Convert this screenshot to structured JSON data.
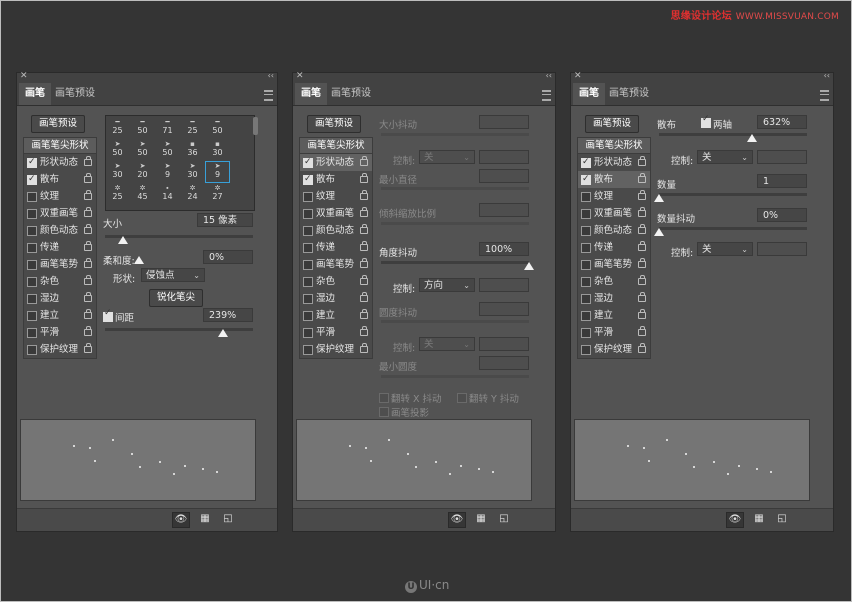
{
  "watermark": {
    "site": "思缘设计论坛",
    "url": "WWW.MISSVUAN.COM"
  },
  "footer_logo": {
    "text": "UI·cn"
  },
  "panels": [
    {
      "tabs": [
        "画笔",
        "画笔预设"
      ],
      "preset_button": "画笔预设",
      "list_header": "画笔笔尖形状",
      "options": [
        {
          "label": "形状动态",
          "checked": true
        },
        {
          "label": "散布",
          "checked": true
        },
        {
          "label": "纹理",
          "checked": false
        },
        {
          "label": "双重画笔",
          "checked": false
        },
        {
          "label": "颜色动态",
          "checked": false
        },
        {
          "label": "传递",
          "checked": false
        },
        {
          "label": "画笔笔势",
          "checked": false
        },
        {
          "label": "杂色",
          "checked": false
        },
        {
          "label": "湿边",
          "checked": false
        },
        {
          "label": "建立",
          "checked": false
        },
        {
          "label": "平滑",
          "checked": false
        },
        {
          "label": "保护纹理",
          "checked": false
        }
      ],
      "brush_sizes": [
        "25",
        "50",
        "71",
        "25",
        "50",
        "50",
        "50",
        "50",
        "36",
        "30",
        "30",
        "20",
        "9",
        "30",
        "9",
        "25",
        "45",
        "14",
        "24",
        "27"
      ],
      "size_label": "大小",
      "size_value": "15 像素",
      "hardness_label": "柔和度:",
      "hardness_value": "0%",
      "shape_label": "形状:",
      "shape_value": "侵蚀点",
      "sharpen_button": "锐化笔尖",
      "spacing_label": "间距",
      "spacing_value": "239%",
      "spacing_checked": true
    },
    {
      "tabs": [
        "画笔",
        "画笔预设"
      ],
      "preset_button": "画笔预设",
      "list_header": "画笔笔尖形状",
      "size_jitter": "大小抖动",
      "control_label": "控制:",
      "control_off": "关",
      "min_diameter": "最小直径",
      "tilt_scale": "倾斜缩放比例",
      "angle_jitter": "角度抖动",
      "angle_jitter_value": "100%",
      "angle_control_value": "方向",
      "roundness_jitter": "圆度抖动",
      "min_roundness": "最小圆度",
      "flip_x": "翻转 X 抖动",
      "flip_y": "翻转 Y 抖动",
      "brush_projection": "画笔投影"
    },
    {
      "tabs": [
        "画笔",
        "画笔预设"
      ],
      "preset_button": "画笔预设",
      "list_header": "画笔笔尖形状",
      "scatter_label": "散布",
      "both_axes_label": "两轴",
      "both_axes_checked": true,
      "scatter_value": "632%",
      "control_label": "控制:",
      "control_value": "关",
      "count_label": "数量",
      "count_value": "1",
      "count_jitter_label": "数量抖动",
      "count_jitter_value": "0%"
    }
  ],
  "sliders": {
    "p1_size": 0.12,
    "p1_hardness": 0.0,
    "p1_spacing": 0.8,
    "p2_angle_jitter": 1.0,
    "p3_scatter": 0.63,
    "p3_count": 0.0,
    "p3_count_jitter": 0.0
  },
  "footer_icons": [
    "eye-brush-icon",
    "grid-icon",
    "new-preset-icon"
  ]
}
